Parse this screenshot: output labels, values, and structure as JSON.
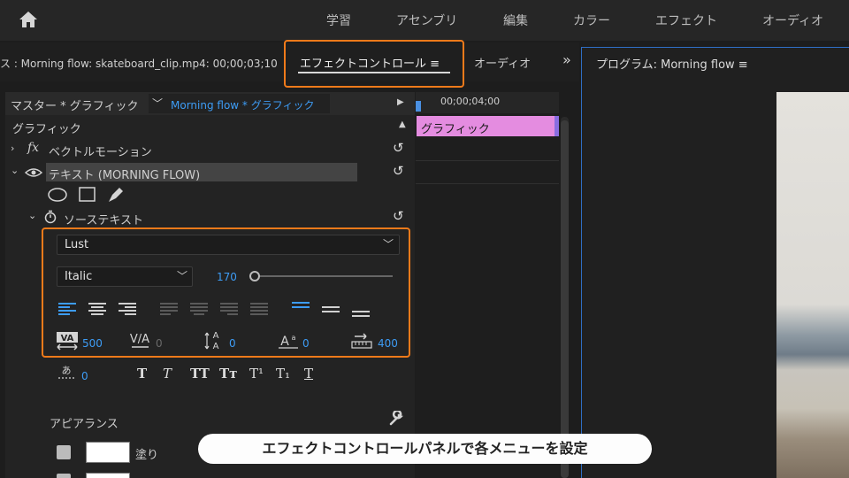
{
  "workspace": {
    "tabs": [
      "学習",
      "アセンブリ",
      "編集",
      "カラー",
      "エフェクト",
      "オーディオ"
    ]
  },
  "panel": {
    "sequence_title": "ス : Morning flow: skateboard_clip.mp4: 00;00;03;10",
    "effect_controls_tab": "エフェクトコントロール ≡",
    "audio_tab": "オーディオ"
  },
  "program": {
    "title": "プログラム: Morning flow  ≡"
  },
  "effect_controls": {
    "master_label": "マスター * グラフィック",
    "clip_label": "Morning flow * グラフィック",
    "section_graphic": "グラフィック",
    "vector_motion": "ベクトルモーション",
    "text_layer": "テキスト (MORNING FLOW)",
    "source_text": "ソーステキスト"
  },
  "timeline": {
    "timecode": "00;00;04;00",
    "clip_label": "グラフィック"
  },
  "text_props": {
    "font": "Lust",
    "style": "Italic",
    "size": "170",
    "size_slider_fraction": 0.04,
    "kerning": "500",
    "tracking": "0",
    "leading": "0",
    "baseline": "0",
    "tsume": "400",
    "tsume2": "0"
  },
  "appearance": {
    "section": "アピアランス",
    "fill_label": "塗り",
    "fill_color": "#ffffff"
  },
  "caption": "エフェクトコントロールパネルで各メニューを設定",
  "colors": {
    "highlight": "#f07a1a",
    "accent_blue": "#3d9cf5",
    "clip_pink": "#e48ce0"
  }
}
